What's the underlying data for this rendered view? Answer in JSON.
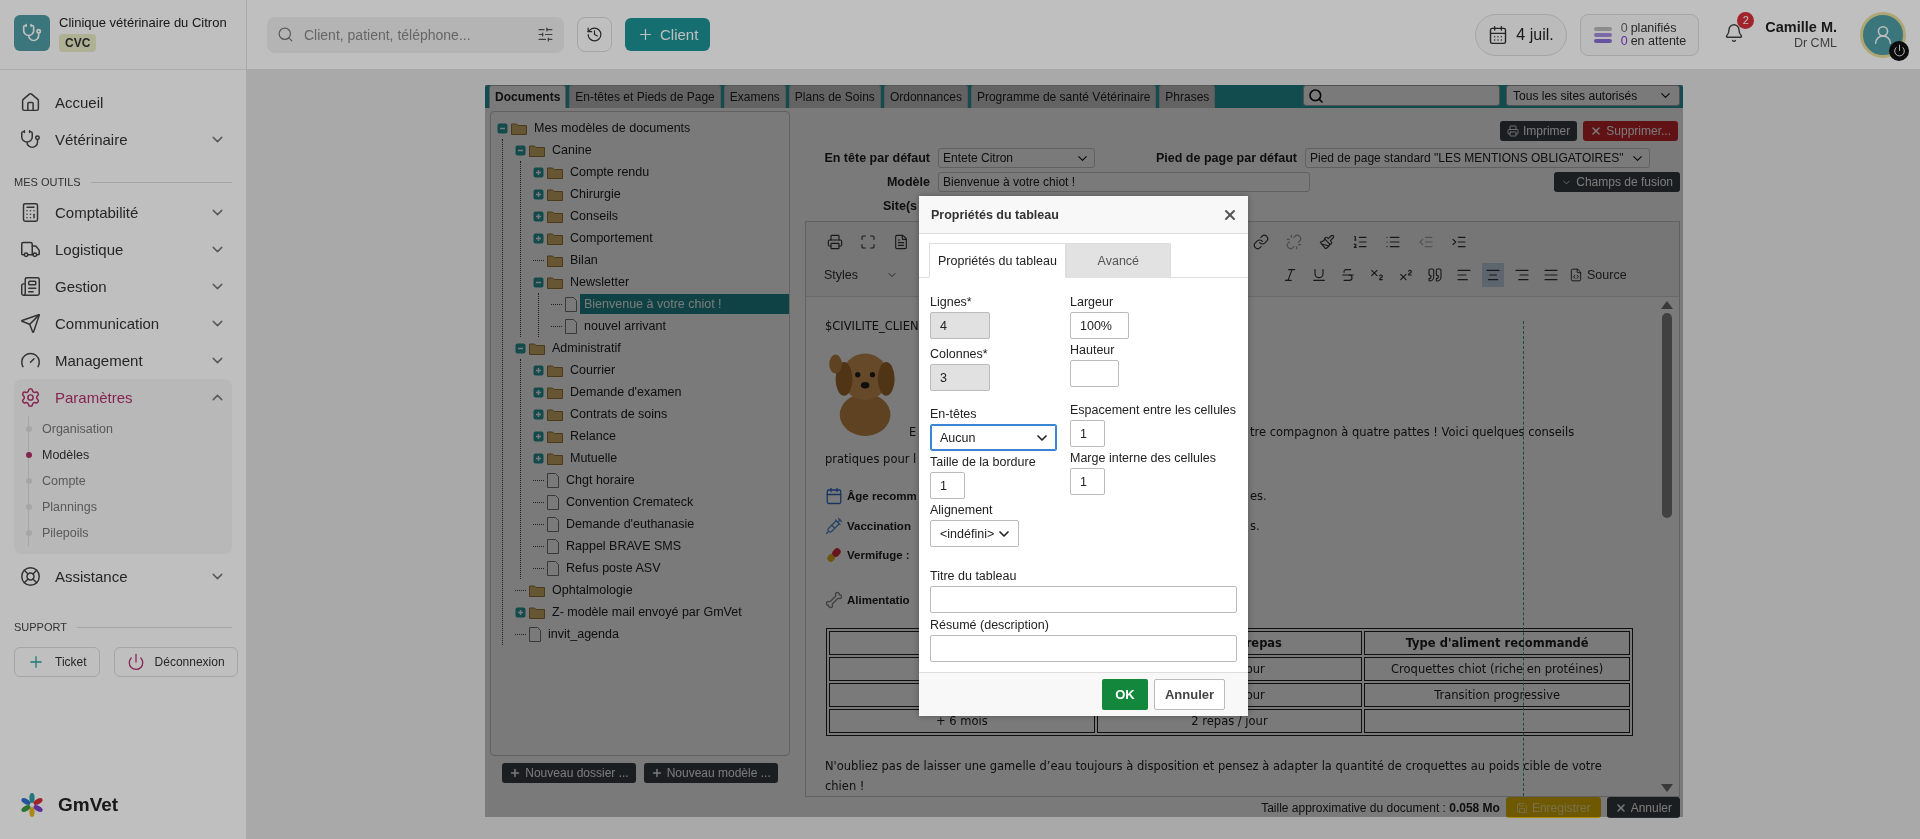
{
  "clinic": {
    "name": "Clinique vétérinaire du Citron",
    "badge": "CVC"
  },
  "nav": [
    {
      "label": "Accueil",
      "selected": false
    },
    {
      "label": "Vétérinaire",
      "expanded": false,
      "selected": false
    }
  ],
  "tools_title": "MES OUTILS",
  "tools": [
    {
      "label": "Comptabilité",
      "expanded": false,
      "selected": false
    },
    {
      "label": "Logistique",
      "expanded": false,
      "selected": false
    },
    {
      "label": "Gestion",
      "expanded": false,
      "selected": false
    },
    {
      "label": "Communication",
      "expanded": false,
      "selected": false
    },
    {
      "label": "Management",
      "expanded": false,
      "selected": false
    },
    {
      "label": "Paramètres",
      "expanded": true,
      "selected": true,
      "children": [
        {
          "label": "Organisation",
          "selected": false
        },
        {
          "label": "Modèles",
          "selected": true
        },
        {
          "label": "Compte",
          "selected": false
        },
        {
          "label": "Plannings",
          "selected": false
        },
        {
          "label": "Pilepoils",
          "selected": false
        }
      ]
    },
    {
      "label": "Assistance",
      "expanded": false,
      "selected": false
    }
  ],
  "support": {
    "title": "SUPPORT",
    "buttons": [
      "Ticket",
      "Déconnexion"
    ]
  },
  "brand": "GmVet",
  "topbar": {
    "search_placeholder": "Client, patient, téléphone...",
    "client_button": "Client",
    "date": "4 juil.",
    "planning": [
      {
        "count": "0",
        "label": "planifiés"
      },
      {
        "count": "0",
        "label": "en attente"
      }
    ],
    "notifications": "2",
    "user_name": "Camille M.",
    "user_role": "Dr CML"
  },
  "editor": {
    "tabs": [
      {
        "label": "Documents",
        "selected": true
      },
      {
        "label": "En-têtes et Pieds de Page",
        "selected": false
      },
      {
        "label": "Examens",
        "selected": false
      },
      {
        "label": "Plans de Soins",
        "selected": false
      },
      {
        "label": "Ordonnances",
        "selected": false
      },
      {
        "label": "Programme de santé Vétérinaire",
        "selected": false
      },
      {
        "label": "Phrases",
        "selected": false
      }
    ],
    "site_filter": "Tous les sites autorisés",
    "tree": [
      {
        "label": "Mes modèles de documents",
        "kind": "folder",
        "expanded": true,
        "selected": false,
        "children": [
          {
            "label": "Canine",
            "kind": "folder",
            "expanded": true,
            "selected": false,
            "children": [
              {
                "label": "Compte rendu",
                "kind": "folder",
                "expanded": false,
                "selected": false
              },
              {
                "label": "Chirurgie",
                "kind": "folder",
                "expanded": false,
                "selected": false
              },
              {
                "label": "Conseils",
                "kind": "folder",
                "expanded": false,
                "selected": false
              },
              {
                "label": "Comportement",
                "kind": "folder",
                "expanded": false,
                "selected": false
              },
              {
                "label": "Bilan",
                "kind": "folder",
                "selected": false
              },
              {
                "label": "Newsletter",
                "kind": "folder",
                "expanded": true,
                "selected": false,
                "children": [
                  {
                    "label": "Bienvenue à votre chiot !",
                    "kind": "file",
                    "selected": true
                  },
                  {
                    "label": "nouvel arrivant",
                    "kind": "file",
                    "selected": false
                  }
                ]
              }
            ]
          },
          {
            "label": "Administratif",
            "kind": "folder",
            "expanded": true,
            "selected": false,
            "children": [
              {
                "label": "Courrier",
                "kind": "folder",
                "expanded": false,
                "selected": false
              },
              {
                "label": "Demande d'examen",
                "kind": "folder",
                "expanded": false,
                "selected": false
              },
              {
                "label": "Contrats de soins",
                "kind": "folder",
                "expanded": false,
                "selected": false
              },
              {
                "label": "Relance",
                "kind": "folder",
                "expanded": false,
                "selected": false
              },
              {
                "label": "Mutuelle",
                "kind": "folder",
                "expanded": false,
                "selected": false
              },
              {
                "label": "Chgt horaire",
                "kind": "file",
                "selected": false
              },
              {
                "label": "Convention Cremateck",
                "kind": "file",
                "selected": false
              },
              {
                "label": "Demande d'euthanasie",
                "kind": "file",
                "selected": false
              },
              {
                "label": "Rappel BRAVE SMS",
                "kind": "file",
                "selected": false
              },
              {
                "label": "Refus poste ASV",
                "kind": "file",
                "selected": false
              }
            ]
          },
          {
            "label": "Ophtalmologie",
            "kind": "folder",
            "selected": false
          },
          {
            "label": "Z- modèle mail envoyé par GmVet",
            "kind": "folder",
            "expanded": false,
            "selected": false
          },
          {
            "label": "invit_agenda",
            "kind": "file",
            "selected": false
          }
        ]
      }
    ],
    "tree_buttons": [
      "Nouveau dossier ...",
      "Nouveau modèle ..."
    ],
    "actions": [
      "Imprimer",
      "Supprimer..."
    ],
    "header_label": "En tête par défaut",
    "header_value": "Entete Citron",
    "footer_label": "Pied de page par défaut",
    "footer_value": "Pied de page standard \"LES MENTIONS OBLIGATOIRES\"",
    "model_label": "Modèle",
    "model_value": "Bienvenue à votre chiot !",
    "site_label": "Site(s",
    "merge_button": "Champs de fusion",
    "styles_label": "Styles",
    "source_label": "Source",
    "alignment_buttons": [
      {
        "selected": false
      },
      {
        "selected": true
      },
      {
        "selected": false
      },
      {
        "selected": false
      }
    ],
    "content": {
      "greeting": "$CIVILITE_CLIEN",
      "intro_left": "E",
      "intro_right": "tre compagnon à quatre pattes ! Voici quelques conseils",
      "intro_second": "pratiques pour l",
      "bullets": [
        {
          "left": "Âge recomm",
          "right": "es."
        },
        {
          "left": "Vaccination",
          "right": "s."
        },
        {
          "left": "Vermifuge :"
        },
        {
          "left": "Alimentatio"
        }
      ],
      "table": [
        {
          "kind": "header",
          "cells": [
            {},
            {
              "text": "repas",
              "cut": true
            },
            {
              "text": "Type d'aliment recommandé",
              "cut": false
            }
          ]
        },
        {
          "kind": "row",
          "cells": [
            {},
            {
              "text": "our",
              "cut": true
            },
            {
              "text": "Croquettes chiot (riche en protéines)",
              "cut": false
            }
          ]
        },
        {
          "kind": "row",
          "cells": [
            {},
            {
              "text": "our",
              "cut": true
            },
            {
              "text": "Transition progressive",
              "cut": false
            }
          ]
        },
        {
          "kind": "row",
          "cells": [
            {
              "text": "+ 6 mois",
              "cut": false
            },
            {
              "text": "2 repas / jour",
              "cut": false
            },
            {}
          ]
        }
      ],
      "closing": "N'oubliez pas de laisser une gamelle d’eau toujours à disposition et pensez à adapter la quantité de croquettes au poids cible de votre chien !"
    },
    "size_label": "Taille approximative du document :",
    "size_value": "0.058 Mo",
    "save_button": "Enregistrer",
    "cancel_button": "Annuler"
  },
  "dialog": {
    "title": "Propriétés du tableau",
    "tabs": [
      {
        "label": "Propriétés du tableau",
        "selected": true
      },
      {
        "label": "Avancé",
        "selected": false
      }
    ],
    "left_fields": [
      {
        "label": "Lignes*",
        "kind": "input",
        "value": "4",
        "disabled": true,
        "focused": false
      },
      {
        "label": "Colonnes*",
        "kind": "input",
        "value": "3",
        "disabled": true,
        "focused": false
      },
      {
        "label": "En-têtes",
        "kind": "select",
        "value": "Aucun",
        "disabled": false,
        "focused": true
      },
      {
        "label": "Taille de la bordure",
        "kind": "input",
        "value": "1",
        "disabled": false,
        "focused": false
      },
      {
        "label": "Alignement",
        "kind": "select",
        "value": "<indéfini>",
        "disabled": false,
        "focused": false
      }
    ],
    "right_fields": [
      {
        "label": "Largeur",
        "kind": "input",
        "value": "100%",
        "disabled": false,
        "focused": false
      },
      {
        "label": "Hauteur",
        "kind": "input",
        "disabled": false,
        "focused": false
      },
      {
        "label": "Espacement entre les cellules",
        "kind": "input",
        "value": "1",
        "disabled": false,
        "focused": false
      },
      {
        "label": "Marge interne des cellules",
        "kind": "input",
        "value": "1",
        "disabled": false,
        "focused": false
      }
    ],
    "bottom_fields": [
      {
        "label": "Titre du tableau",
        "kind": "input",
        "disabled": false,
        "focused": false
      },
      {
        "label": "Résumé (description)",
        "kind": "input",
        "disabled": false,
        "focused": false
      }
    ],
    "ok": "OK",
    "cancel": "Annuler"
  }
}
